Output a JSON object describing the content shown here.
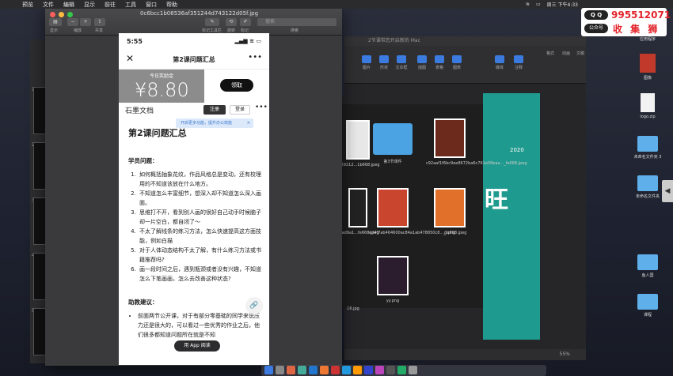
{
  "menubar": {
    "items": [
      "预览",
      "文件",
      "编辑",
      "显示",
      "前往",
      "工具",
      "窗口",
      "帮助"
    ],
    "clock": "周三 下午4:33"
  },
  "watermark": {
    "qq_label": "Q Q",
    "qq_number": "995512071",
    "gzh_label": "公众号",
    "name": "收 集 狮"
  },
  "preview": {
    "filename": "0c6bcc1b06536af351244d743122d05f.jpg",
    "toolbar": {
      "display_label": "显示",
      "zoom_label": "缩放",
      "share_label": "共享",
      "markup_label": "标记工具栏",
      "rotate_label": "旋转",
      "markup2_label": "标记",
      "search_placeholder": "搜索",
      "search_label": "搜索"
    }
  },
  "phone": {
    "time": "5:55",
    "indicators": "▂▄▆ ≋ ▭",
    "nav_title": "第2课问题汇总",
    "reward_label": "今日奖励金",
    "reward_amount": "¥8.80",
    "claim_button": "领取",
    "brand": "石墨文档",
    "register_button": "注册",
    "login_button": "登录",
    "tip_text": "开启更多功能，提升办公效能",
    "doc_title": "第2课问题汇总",
    "section_students": "学员问题：",
    "questions": [
      "如何概括抽象花纹，作品风格总是变动，还有校理用的不知道该放在什么地方。",
      "不知道怎么丰富细节，想深入却不知道怎么深入画面。",
      "思维打不开，看到别人画的很好自己动手时候脑子却一片空白，都自闭了～",
      "不太了解线条的练习方法，怎么快速提高这方面技能，例如白描",
      "对于人体动态结构不太了解，有什么练习方法或书籍推荐吗?",
      "画一段时间之后，遇到瓶颈或者没有兴趣，不知道怎么下笔画画，怎么去改善这种状态?"
    ],
    "section_assistant": "助教建议：",
    "suggestions": [
      "前面两节公开课，对于有部分零基础的同学来说压力还是很大的，可以看过一些优秀的作业之后，他们很多都知道问题所在就是不知"
    ],
    "open_app_button": "用 App 阅读"
  },
  "keynote": {
    "title": "2节课带您开启新的 Mac",
    "tools": [
      "图片",
      "形状",
      "文本框",
      "插图",
      "表格",
      "图表",
      "媒体",
      "注释"
    ],
    "zoom": "55%",
    "slide_year": "2020",
    "slide_text": "旺",
    "right_buttons": [
      "格式",
      "动画",
      "文稿"
    ]
  },
  "finder_files": [
    "ad59212...1b668.jpeg",
    "第3节课件",
    "c92aaf1f6bc9ee8672ba6c761e08eaa..._fe668.jpeg",
    "ed4f7ab464600ac84a1ab478850c8..._fe668.jpeg",
    "g.png",
    "52ad9a1...fe668.jpeg",
    "yy.png",
    "16.jpg"
  ],
  "desktop_icons": [
    "guiwazi",
    "应用程序",
    "图像",
    "logo.zip",
    "未命名文件夹 3",
    "未命名文件夹",
    "鱼人国",
    "课程"
  ],
  "colors": {
    "teal": "#1f9a8e",
    "folder_blue": "#4ba3e3",
    "watermark_red": "#e3242b"
  }
}
